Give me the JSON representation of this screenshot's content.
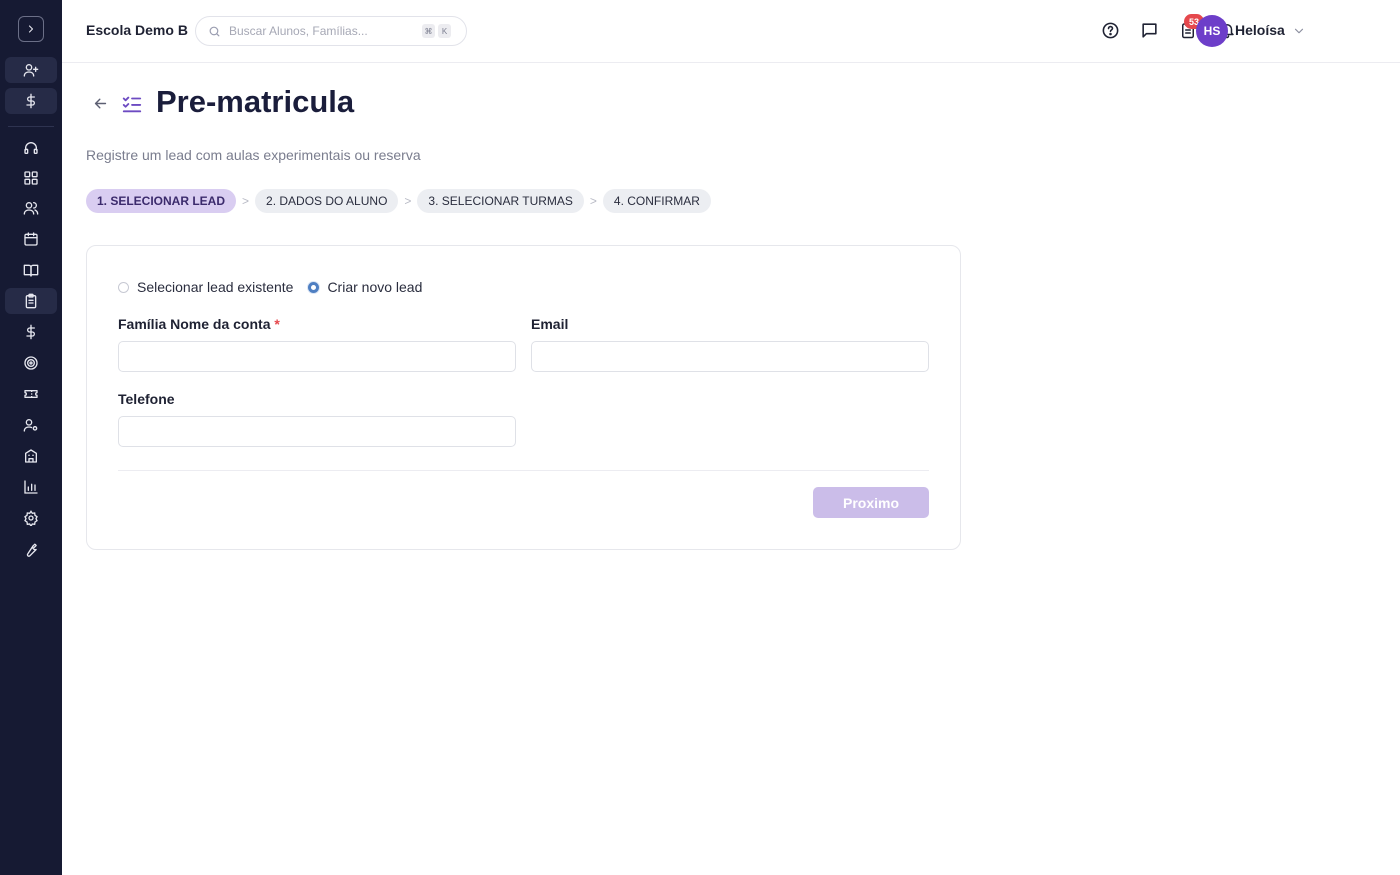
{
  "header": {
    "school_name": "Escola Demo B",
    "search_placeholder": "Buscar Alunos, Famílias...",
    "shortcut_keys": [
      "⌘",
      "K"
    ],
    "tasks_badge": "53",
    "user_initials": "HS",
    "user_name": "Heloísa"
  },
  "page": {
    "title": "Pre-matricula",
    "subtitle": "Registre um lead com aulas experimentais ou reserva"
  },
  "steps": [
    {
      "label": "1. SELECIONAR LEAD",
      "active": true
    },
    {
      "label": "2. DADOS DO ALUNO",
      "active": false
    },
    {
      "label": "3. SELECIONAR TURMAS",
      "active": false
    },
    {
      "label": "4. CONFIRMAR",
      "active": false
    }
  ],
  "step_separator": ">",
  "form": {
    "radio_existing": "Selecionar lead existente",
    "radio_new": "Criar novo lead",
    "selected": "new",
    "family_label": "Família Nome da conta",
    "required_mark": "*",
    "email_label": "Email",
    "phone_label": "Telefone",
    "family_value": "",
    "email_value": "",
    "phone_value": "",
    "next_label": "Proximo"
  },
  "colors": {
    "sidebar_bg": "#161a33",
    "accent_active_step": "#d9cdf1",
    "next_button_disabled": "#cbbde9",
    "avatar": "#6d3ec9",
    "badge": "#e5484d"
  }
}
